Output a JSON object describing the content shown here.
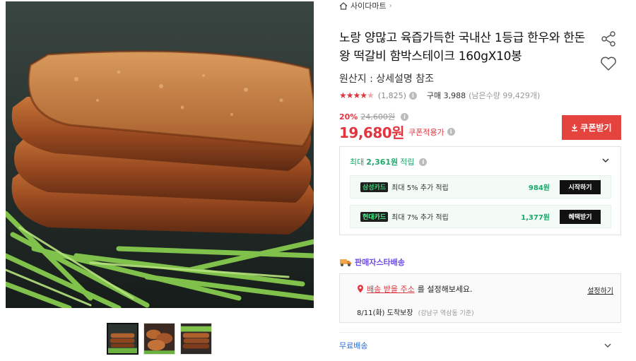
{
  "shop": {
    "name": "사이다마트",
    "icon": "home-icon"
  },
  "product": {
    "title": "노랑 양많고 육즙가득한 국내산 1등급 한우와 한돈 왕 떡갈비 함박스테이크 160gX10봉",
    "origin": "원산지 : 상세설명 참조",
    "rating": {
      "stars": 4.5,
      "review_count": "(1,825)",
      "purchase": "구매 3,988",
      "remaining": "(남은수량 99,429개)"
    },
    "discount_rate": "20%",
    "original_price": "24,600원",
    "price": "19,680원",
    "coupon_note": "쿠폰적용가",
    "coupon_button": "쿠폰받기"
  },
  "points": {
    "label_prefix": "최대",
    "amount": "2,361원",
    "label_suffix": "적립",
    "cards": [
      {
        "brand": "삼성카드",
        "desc": "최대 5% 추가 적립",
        "amount": "984원",
        "button": "시작하기"
      },
      {
        "brand": "현대카드",
        "desc": "최대 7% 추가 적립",
        "amount": "1,377원",
        "button": "혜택받기"
      }
    ]
  },
  "delivery": {
    "brand": "판매자스타배송",
    "address_link": "배송 받을 주소",
    "address_suffix": "를 설정해보세요.",
    "set_link": "설정하기",
    "arrival": "8/11(화) 도착보장",
    "arrival_location": "(강남구 역삼동 기준)"
  },
  "shipping": {
    "label": "무료배송"
  },
  "colors": {
    "accent_red": "#e0363f",
    "coupon_btn": "#e5433d",
    "point_green": "#1aa86a",
    "delivery_purple": "#6b4ce6",
    "link_blue": "#2c6bd6"
  }
}
